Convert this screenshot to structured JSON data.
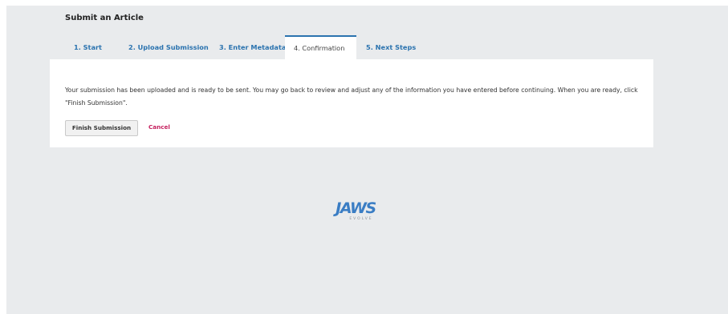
{
  "page": {
    "title": "Submit an Article"
  },
  "tabs": [
    {
      "label": "1. Start",
      "active": false
    },
    {
      "label": "2. Upload Submission",
      "active": false
    },
    {
      "label": "3. Enter Metadata",
      "active": false
    },
    {
      "label": "4. Confirmation",
      "active": true
    },
    {
      "label": "5. Next Steps",
      "active": false
    }
  ],
  "confirmation": {
    "message": "Your submission has been uploaded and is ready to be sent. You may go back to review and adjust any of the information you have entered before continuing. When you are ready, click \"Finish Submission\".",
    "finish_label": "Finish Submission",
    "cancel_label": "Cancel"
  },
  "footer": {
    "logo_text": "JAWS",
    "logo_tagline": "EVOLVE"
  },
  "colors": {
    "accent": "#2b73af",
    "cancel": "#c5215f",
    "background": "#e9ebed",
    "logo": "#3a7dc4"
  }
}
